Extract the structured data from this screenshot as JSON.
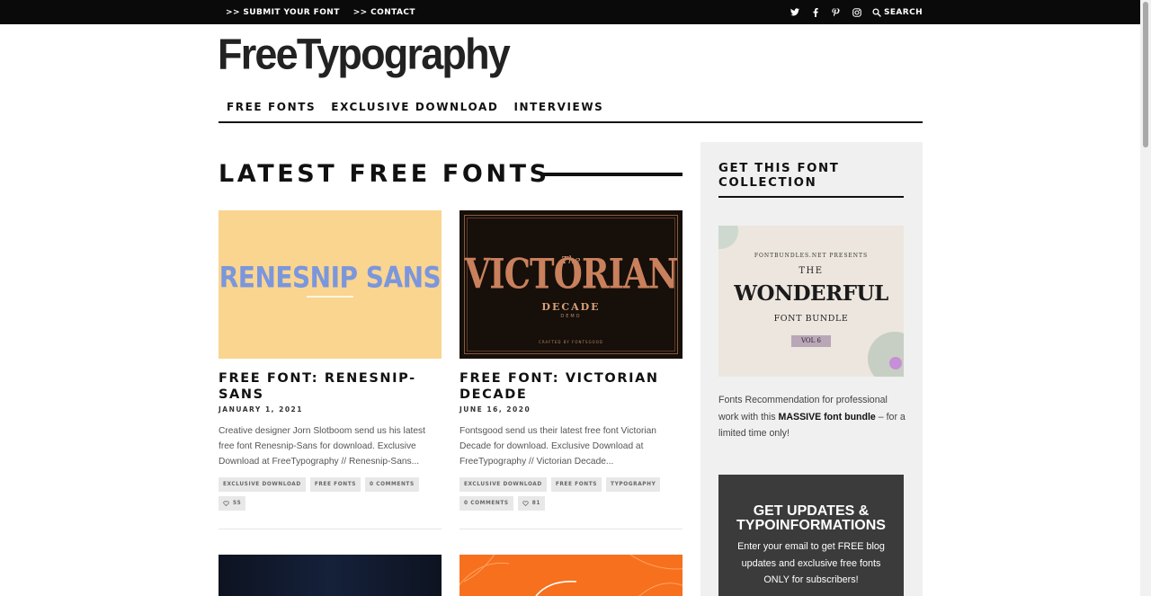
{
  "topbar": {
    "links": [
      ">> SUBMIT YOUR FONT",
      ">> CONTACT"
    ],
    "social_icons": [
      "twitter-icon",
      "facebook-icon",
      "pinterest-icon",
      "instagram-icon"
    ],
    "search_label": "SEARCH"
  },
  "logo": "FreeTypography",
  "nav": [
    "FREE FONTS",
    "EXCLUSIVE DOWNLOAD",
    "INTERVIEWS"
  ],
  "section_title": "LATEST FREE FONTS",
  "posts": [
    {
      "image_text": "RENESNIP SANS",
      "title": "FREE FONT: RENESNIP-SANS",
      "date": "JANUARY 1, 2021",
      "excerpt": "Creative designer Jorn Slotboom send us his latest free font Renesnip-Sans for download. Exclusive Download at FreeTypography // Renesnip-Sans...",
      "tags": [
        "EXCLUSIVE DOWNLOAD",
        "FREE FONTS",
        "0 COMMENTS"
      ],
      "likes": "55"
    },
    {
      "image_text": {
        "small": "The",
        "big": "VICTORIAN",
        "sub": "DECADE",
        "demo": "DEMO",
        "footer": "CRAFTED BY FONTSGOOD"
      },
      "title": "FREE FONT: VICTORIAN DECADE",
      "date": "JUNE 16, 2020",
      "excerpt": "Fontsgood send us their latest free font Victorian Decade for download. Exclusive Download at FreeTypography // Victorian Decade...",
      "tags": [
        "EXCLUSIVE DOWNLOAD",
        "FREE FONTS",
        "TYPOGRAPHY",
        "0 COMMENTS"
      ],
      "likes": "81"
    }
  ],
  "sidebar": {
    "title": "GET THIS FONT COLLECTION",
    "ad": {
      "arc": "FONTBUNDLES.NET PRESENTS",
      "the": "THE",
      "big": "WONDERFUL",
      "sub": "FONT BUNDLE",
      "vol": "VOL 6"
    },
    "text_pre": "Fonts Recommendation for professional work with this ",
    "text_bold": "MASSIVE font bundle",
    "text_post": " – for a limited time only!",
    "subscribe_title": "GET UPDATES & TYPOINFORMATIONS",
    "subscribe_text": "Enter your email to get FREE blog updates and exclusive free fonts ONLY for subscribers!"
  },
  "colors": {
    "topbar_bg": "#0a0a0a",
    "renesnip_bg": "#f9d590",
    "renesnip_text": "#7b96dc",
    "victorian_bg": "#160f0a",
    "victorian_text": "#c9805c",
    "orange": "#f7701e",
    "sidebar_bg": "#f0f0f0",
    "subscribe_bg": "#3b3b3b"
  }
}
